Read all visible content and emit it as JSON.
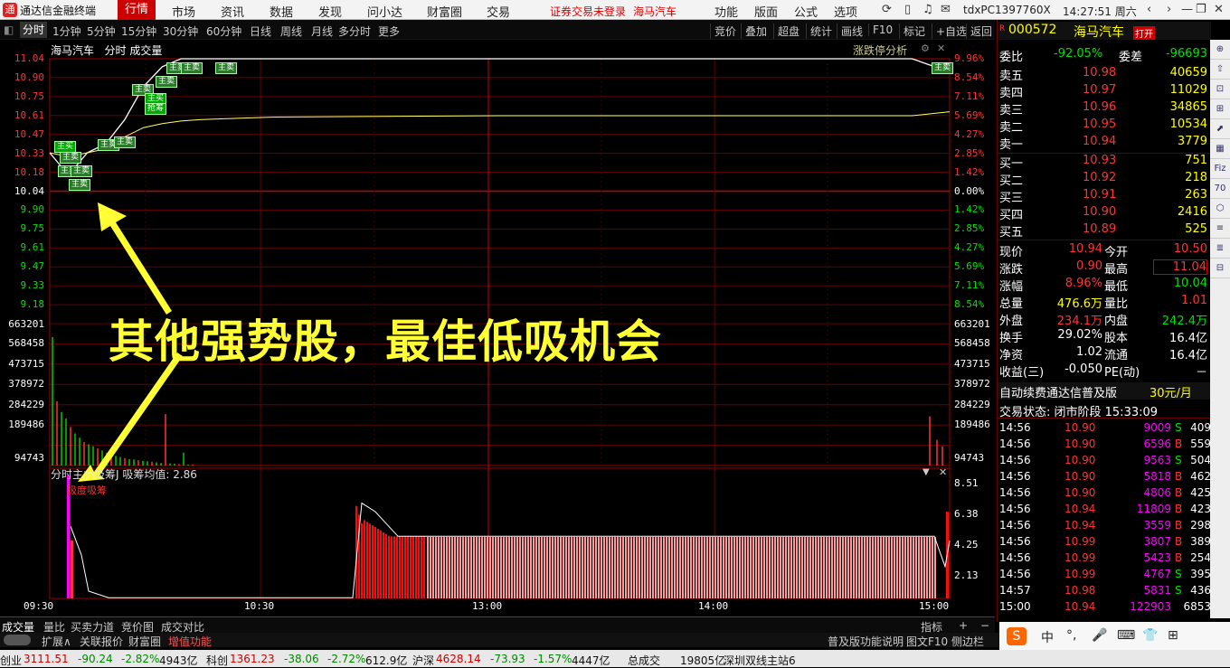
{
  "app": {
    "title": "通达信金融终端",
    "logo_char": "通"
  },
  "menu": [
    {
      "label": "行情",
      "active": true
    },
    {
      "label": "市场"
    },
    {
      "label": "资讯"
    },
    {
      "label": "数据"
    },
    {
      "label": "发现"
    },
    {
      "label": "问小达"
    },
    {
      "label": "财富圈"
    },
    {
      "label": "交易"
    }
  ],
  "topbar": {
    "login_notice": "证券交易未登录",
    "stock_name": "海马汽车",
    "right_menu": [
      "功能",
      "版面",
      "公式",
      "选项"
    ],
    "pc_id": "tdxPC1397760X",
    "clock": "14:27:51 周六"
  },
  "toolbar": {
    "left": [
      "分时",
      "1分钟",
      "5分钟",
      "15分钟",
      "30分钟",
      "60分钟",
      "日线",
      "周线",
      "月线",
      "多分时",
      "更多"
    ],
    "right": [
      "竞价",
      "叠加",
      "超盘",
      "统计",
      "画线",
      "F10",
      "标记",
      "+自选",
      "返回"
    ]
  },
  "chart_header": {
    "name": "海马汽车",
    "mode": "分时",
    "series": "成交量",
    "tool": "涨跌停分析"
  },
  "price_axis": {
    "left": [
      "11.04",
      "10.90",
      "10.75",
      "10.61",
      "10.47",
      "10.33",
      "10.18",
      "10.04",
      "9.90",
      "9.75",
      "9.61",
      "9.47",
      "9.33",
      "9.18"
    ],
    "right": [
      "9.96%",
      "8.54%",
      "7.11%",
      "5.69%",
      "4.27%",
      "2.85%",
      "1.42%",
      "0.00%",
      "1.42%",
      "2.85%",
      "4.27%",
      "5.69%",
      "7.11%",
      "8.54%"
    ]
  },
  "volume_axis": {
    "labels": [
      "663201",
      "568458",
      "473715",
      "378972",
      "284229",
      "189486",
      "94743"
    ]
  },
  "indicator": {
    "title": "分时主力吸筹J 吸筹均值: 2.86",
    "label": "极度吸筹",
    "axis": [
      "8.51",
      "6.38",
      "4.25",
      "2.13"
    ]
  },
  "time_axis": [
    "09:30",
    "10:30",
    "13:00",
    "14:00",
    "15:00"
  ],
  "chart_data": {
    "type": "line",
    "title": "海马汽车 分时",
    "prev_close": 10.04,
    "ylim": [
      9.04,
      11.04
    ],
    "x": [
      "09:30",
      "09:35",
      "09:40",
      "09:45",
      "09:50",
      "09:55",
      "10:00",
      "10:05",
      "10:10",
      "10:20",
      "10:30",
      "11:30",
      "13:00",
      "14:00",
      "14:50",
      "15:00"
    ],
    "series": [
      {
        "name": "价格",
        "values": [
          10.33,
          10.16,
          10.33,
          10.4,
          10.58,
          10.83,
          10.98,
          11.04,
          11.04,
          11.04,
          11.04,
          11.04,
          11.04,
          11.04,
          11.04,
          10.94
        ]
      },
      {
        "name": "均价",
        "values": [
          10.33,
          10.3,
          10.33,
          10.36,
          10.45,
          10.52,
          10.55,
          10.57,
          10.58,
          10.59,
          10.6,
          10.61,
          10.61,
          10.61,
          10.61,
          10.64
        ]
      }
    ],
    "volume": {
      "ylim": [
        0,
        663201
      ],
      "values": [
        600000,
        300000,
        250000,
        220000,
        180000,
        150000,
        130000,
        110000,
        100000,
        90000,
        80000,
        70000,
        60000,
        50000,
        45000,
        40000,
        35000,
        30000,
        28000,
        25000,
        22000,
        20000,
        18000,
        15000,
        12000,
        240000,
        10000,
        8000,
        6000,
        60000,
        5000,
        4000
      ]
    },
    "indicator": {
      "ylim": [
        0,
        8.51
      ],
      "values": [
        8.5,
        4.0,
        1.0,
        0.3,
        0.1,
        0.0,
        0.0,
        0.0,
        6.4,
        6.0,
        5.2,
        4.6,
        4.3,
        4.25,
        4.25,
        4.25,
        4.25,
        4.25,
        4.25,
        4.25,
        4.25,
        4.25,
        4.25,
        4.25,
        4.25,
        4.25,
        4.25,
        4.25,
        4.25,
        4.25,
        4.25,
        4.25,
        4.25,
        2.2,
        6.0
      ]
    }
  },
  "trade_tags": [
    "主买",
    "主卖",
    "主卖",
    "主卖",
    "主卖",
    "主卖",
    "主卖",
    "主卖",
    "主买",
    "主卖",
    "抢筹",
    "主卖",
    "主卖",
    "主卖",
    "主卖"
  ],
  "overlay_text": "其他强势股，最佳低吸机会",
  "quote": {
    "code": "000572",
    "name": "海马汽车",
    "badge": "打开",
    "prefix": "R",
    "weibi": {
      "label": "委比",
      "value": "-92.05%",
      "diff_label": "委差",
      "diff": "-96693"
    },
    "sells": [
      {
        "label": "卖五",
        "price": "10.98",
        "vol": "40659"
      },
      {
        "label": "卖四",
        "price": "10.97",
        "vol": "11029"
      },
      {
        "label": "卖三",
        "price": "10.96",
        "vol": "34865"
      },
      {
        "label": "卖二",
        "price": "10.95",
        "vol": "10534"
      },
      {
        "label": "卖一",
        "price": "10.94",
        "vol": "3779"
      }
    ],
    "buys": [
      {
        "label": "买一",
        "price": "10.93",
        "vol": "751"
      },
      {
        "label": "买二",
        "price": "10.92",
        "vol": "218"
      },
      {
        "label": "买三",
        "price": "10.91",
        "vol": "263"
      },
      {
        "label": "买四",
        "price": "10.90",
        "vol": "2416"
      },
      {
        "label": "买五",
        "price": "10.89",
        "vol": "525"
      }
    ],
    "stats": [
      {
        "l1": "现价",
        "v1": "10.94",
        "l2": "今开",
        "v2": "10.50"
      },
      {
        "l1": "涨跌",
        "v1": "0.90",
        "l2": "最高",
        "v2": "11.04"
      },
      {
        "l1": "涨幅",
        "v1": "8.96%",
        "l2": "最低",
        "v2": "10.04"
      },
      {
        "l1": "总量",
        "v1": "476.6万",
        "l2": "量比",
        "v2": "1.01"
      },
      {
        "l1": "外盘",
        "v1": "234.1万",
        "l2": "内盘",
        "v2": "242.4万"
      },
      {
        "l1": "换手",
        "v1": "29.02%",
        "l2": "股本",
        "v2": "16.4亿"
      },
      {
        "l1": "净资",
        "v1": "1.02",
        "l2": "流通",
        "v2": "16.4亿"
      },
      {
        "l1": "收益(三)",
        "v1": "-0.050",
        "l2": "PE(动)",
        "v2": "－"
      }
    ],
    "ad": {
      "text": "自动续费通达信普及版",
      "price": "30元/月"
    },
    "trade_status": {
      "text": "交易状态: 闭市阶段 15:33:09"
    },
    "ticks": [
      {
        "t": "14:56",
        "p": "10.90",
        "v": "9009",
        "s": "S",
        "n": "409"
      },
      {
        "t": "14:56",
        "p": "10.90",
        "v": "6596",
        "s": "B",
        "n": "559"
      },
      {
        "t": "14:56",
        "p": "10.90",
        "v": "9563",
        "s": "S",
        "n": "504"
      },
      {
        "t": "14:56",
        "p": "10.90",
        "v": "5818",
        "s": "B",
        "n": "462"
      },
      {
        "t": "14:56",
        "p": "10.90",
        "v": "4806",
        "s": "B",
        "n": "425"
      },
      {
        "t": "14:56",
        "p": "10.94",
        "v": "11809",
        "s": "B",
        "n": "423"
      },
      {
        "t": "14:56",
        "p": "10.94",
        "v": "3559",
        "s": "B",
        "n": "298"
      },
      {
        "t": "14:56",
        "p": "10.99",
        "v": "3807",
        "s": "B",
        "n": "389"
      },
      {
        "t": "14:56",
        "p": "10.99",
        "v": "5423",
        "s": "B",
        "n": "254"
      },
      {
        "t": "14:56",
        "p": "10.99",
        "v": "4767",
        "s": "S",
        "n": "395"
      },
      {
        "t": "14:57",
        "p": "10.98",
        "v": "5831",
        "s": "S",
        "n": "436"
      },
      {
        "t": "15:00",
        "p": "10.94",
        "v": "122903",
        "s": "",
        "n": "6853"
      }
    ]
  },
  "bottom_tabs": [
    "成交量",
    "量比",
    "买卖力道",
    "竞价图",
    "成交对比"
  ],
  "bottom_right": [
    "指标",
    "+",
    "−"
  ],
  "ext_bar": {
    "items": [
      "扩展∧",
      "关联报价",
      "财富圈",
      "增值功能"
    ],
    "right": [
      "普及版功能说明",
      "图文F10",
      "侧边栏"
    ]
  },
  "status": [
    {
      "label": "创业",
      "value": "3111.51",
      "chg": "-90.24",
      "pct": "-2.82%",
      "amt": "4943亿"
    },
    {
      "label": "科创",
      "value": "1361.23",
      "chg": "-38.06",
      "pct": "-2.72%",
      "amt": "612.9亿"
    },
    {
      "label": "沪深",
      "value": "4628.14",
      "chg": "-73.93",
      "pct": "-1.57%",
      "amt": "4447亿"
    }
  ],
  "status_extra": {
    "total_label": "总成交",
    "total": "19805亿",
    "server": "深圳双线主站6"
  },
  "ime": [
    "中",
    "°,",
    "🎤",
    "⌨",
    "👕",
    "⊞"
  ],
  "sidebar_icons": [
    "⊕",
    "⇧",
    "⊡",
    "⊞",
    "⬈",
    "▦",
    "Fiz",
    "70",
    "⬡",
    "≡",
    "≣",
    "⊟"
  ]
}
